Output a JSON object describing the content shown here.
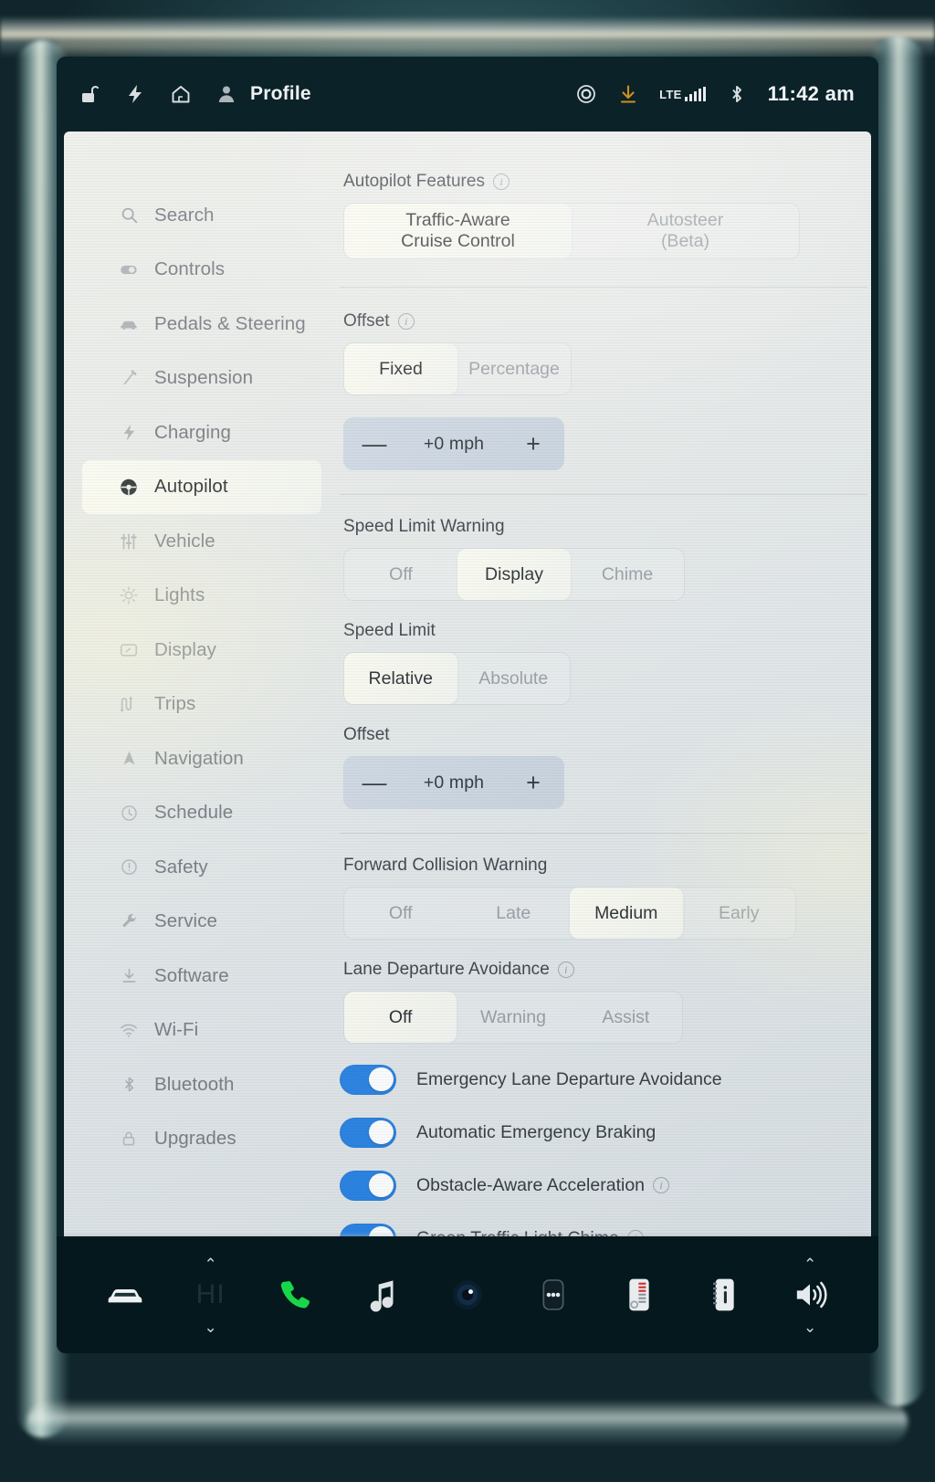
{
  "statusbar": {
    "left_icons": [
      {
        "name": "unlock-icon",
        "glyph": "unlock"
      },
      {
        "name": "charge-bolt-icon",
        "glyph": "bolt"
      },
      {
        "name": "home-icon",
        "glyph": "home"
      },
      {
        "name": "profile-avatar-icon",
        "glyph": "person"
      }
    ],
    "profile_label": "Profile",
    "right": {
      "record_icon": "record-circle-icon",
      "download_icon": "software-download-icon",
      "network_type": "LTE",
      "signal_bars": 5,
      "bluetooth_icon": "bluetooth-icon",
      "time": "11:42 am"
    },
    "accent_download_color": "#e09a1a"
  },
  "sidebar": {
    "items": [
      {
        "icon": "search-icon",
        "label": "Search",
        "active": false
      },
      {
        "icon": "controls-icon",
        "label": "Controls",
        "active": false
      },
      {
        "icon": "car-icon",
        "label": "Pedals & Steering",
        "active": false
      },
      {
        "icon": "suspension-icon",
        "label": "Suspension",
        "active": false
      },
      {
        "icon": "bolt-icon",
        "label": "Charging",
        "active": false
      },
      {
        "icon": "steering-wheel-icon",
        "label": "Autopilot",
        "active": true
      },
      {
        "icon": "sliders-icon",
        "label": "Vehicle",
        "active": false
      },
      {
        "icon": "sun-icon",
        "label": "Lights",
        "active": false
      },
      {
        "icon": "display-icon",
        "label": "Display",
        "active": false
      },
      {
        "icon": "route-icon",
        "label": "Trips",
        "active": false
      },
      {
        "icon": "navigation-arrow-icon",
        "label": "Navigation",
        "active": false
      },
      {
        "icon": "clock-icon",
        "label": "Schedule",
        "active": false
      },
      {
        "icon": "alert-circle-icon",
        "label": "Safety",
        "active": false
      },
      {
        "icon": "wrench-icon",
        "label": "Service",
        "active": false
      },
      {
        "icon": "download-icon",
        "label": "Software",
        "active": false
      },
      {
        "icon": "wifi-icon",
        "label": "Wi-Fi",
        "active": false
      },
      {
        "icon": "bluetooth-icon",
        "label": "Bluetooth",
        "active": false
      },
      {
        "icon": "lock-icon",
        "label": "Upgrades",
        "active": false
      }
    ]
  },
  "main": {
    "autopilot_features": {
      "title": "Autopilot Features",
      "has_info": true,
      "options": [
        "Traffic-Aware\nCruise Control",
        "Autosteer\n(Beta)"
      ],
      "selected": 0
    },
    "offset_mode": {
      "title": "Offset",
      "has_info": true,
      "options": [
        "Fixed",
        "Percentage"
      ],
      "selected": 0
    },
    "offset_stepper_1": {
      "minus": "—",
      "value": "+0 mph",
      "plus": "+"
    },
    "speed_limit_warning": {
      "title": "Speed Limit Warning",
      "has_info": false,
      "options": [
        "Off",
        "Display",
        "Chime"
      ],
      "selected": 1
    },
    "speed_limit": {
      "title": "Speed Limit",
      "has_info": false,
      "options": [
        "Relative",
        "Absolute"
      ],
      "selected": 0
    },
    "offset_2": {
      "title": "Offset",
      "has_info": false
    },
    "offset_stepper_2": {
      "minus": "—",
      "value": "+0 mph",
      "plus": "+"
    },
    "forward_collision_warning": {
      "title": "Forward Collision Warning",
      "has_info": false,
      "options": [
        "Off",
        "Late",
        "Medium",
        "Early"
      ],
      "selected": 2
    },
    "lane_departure_avoidance": {
      "title": "Lane Departure Avoidance",
      "has_info": true,
      "options": [
        "Off",
        "Warning",
        "Assist"
      ],
      "selected": 0
    },
    "toggles": [
      {
        "label": "Emergency Lane Departure Avoidance",
        "on": true,
        "has_info": false
      },
      {
        "label": "Automatic Emergency Braking",
        "on": true,
        "has_info": false
      },
      {
        "label": "Obstacle-Aware Acceleration",
        "on": true,
        "has_info": true
      },
      {
        "label": "Green Traffic Light Chime",
        "on": true,
        "has_info": true
      }
    ],
    "toggle_on_color": "#1577e0"
  },
  "dock": {
    "items": [
      {
        "name": "car-controls",
        "icon": "car-icon"
      },
      {
        "name": "climate-temperature",
        "icon": "temperature-text",
        "value": "HI",
        "chev_up": "⌃",
        "chev_down": "⌄"
      },
      {
        "name": "phone",
        "icon": "phone-icon",
        "color": "#18d64a"
      },
      {
        "name": "media",
        "icon": "music-note-icon"
      },
      {
        "name": "camera",
        "icon": "camera-icon"
      },
      {
        "name": "more-apps",
        "icon": "dots-icon"
      },
      {
        "name": "seat-heater",
        "icon": "seat-heater-icon"
      },
      {
        "name": "vehicle-info",
        "icon": "info-card-icon"
      },
      {
        "name": "volume",
        "icon": "speaker-icon",
        "chev_up": "⌃",
        "chev_down": "⌄"
      }
    ]
  }
}
